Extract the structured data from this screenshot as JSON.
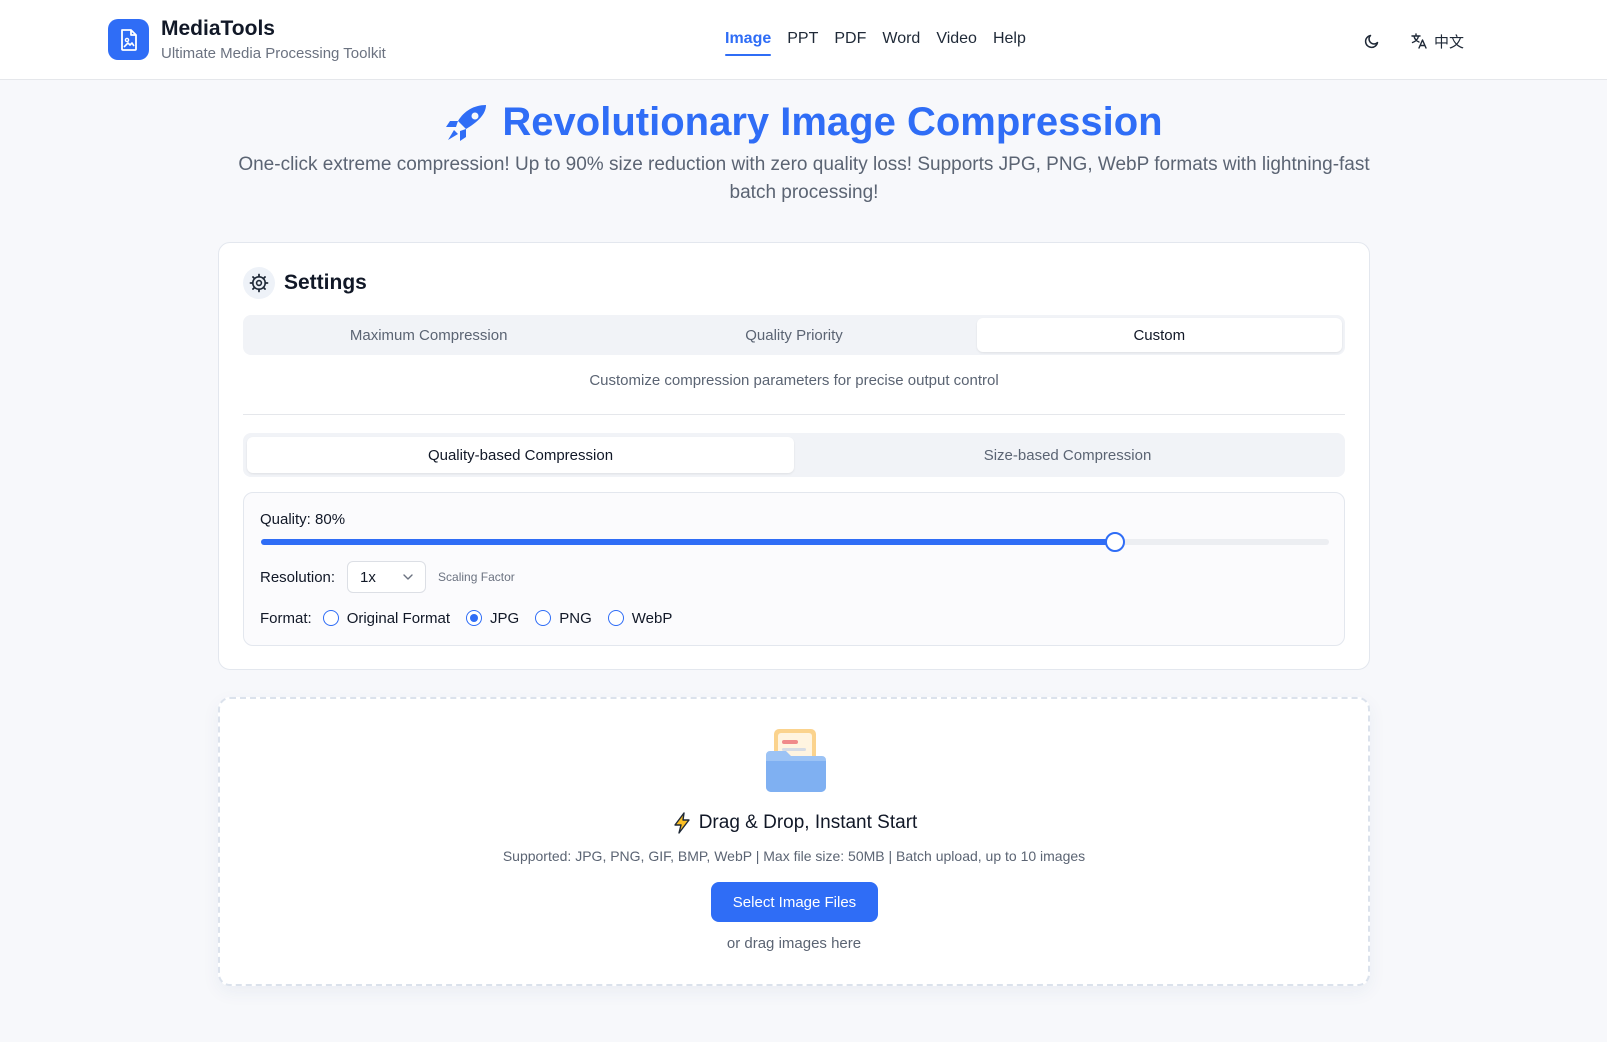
{
  "brand": {
    "title": "MediaTools",
    "subtitle": "Ultimate Media Processing Toolkit",
    "accent": "#2f6df6"
  },
  "nav": {
    "items": [
      {
        "label": "Image",
        "active": true
      },
      {
        "label": "PPT"
      },
      {
        "label": "PDF"
      },
      {
        "label": "Word"
      },
      {
        "label": "Video"
      },
      {
        "label": "Help"
      }
    ],
    "theme_icon": "moon-icon",
    "lang_icon": "translate-icon",
    "lang_label": "中文"
  },
  "hero": {
    "icon": "rocket-icon",
    "title": "Revolutionary Image Compression",
    "subtitle": "One-click extreme compression! Up to 90% size reduction with zero quality loss! Supports JPG, PNG, WebP formats with lightning-fast batch processing!"
  },
  "settings": {
    "icon": "gear-icon",
    "title": "Settings",
    "presets": [
      {
        "label": "Maximum Compression"
      },
      {
        "label": "Quality Priority"
      },
      {
        "label": "Custom",
        "active": true
      }
    ],
    "preset_description": "Customize compression parameters for precise output control",
    "modes": [
      {
        "label": "Quality-based Compression",
        "active": true
      },
      {
        "label": "Size-based Compression"
      }
    ],
    "quality_label": "Quality: 80%",
    "quality_value": 80,
    "resolution_label": "Resolution:",
    "resolution_value": "1x",
    "resolution_hint": "Scaling Factor",
    "format_label": "Format:",
    "formats": [
      {
        "label": "Original Format",
        "checked": false
      },
      {
        "label": "JPG",
        "checked": true
      },
      {
        "label": "PNG",
        "checked": false
      },
      {
        "label": "WebP",
        "checked": false
      }
    ]
  },
  "upload": {
    "icon": "folder-icon",
    "title_icon": "lightning-icon",
    "title": "Drag & Drop, Instant Start",
    "description": "Supported: JPG, PNG, GIF, BMP, WebP | Max file size: 50MB | Batch upload, up to 10 images",
    "button_label": "Select Image Files",
    "or_text": "or drag images here"
  }
}
